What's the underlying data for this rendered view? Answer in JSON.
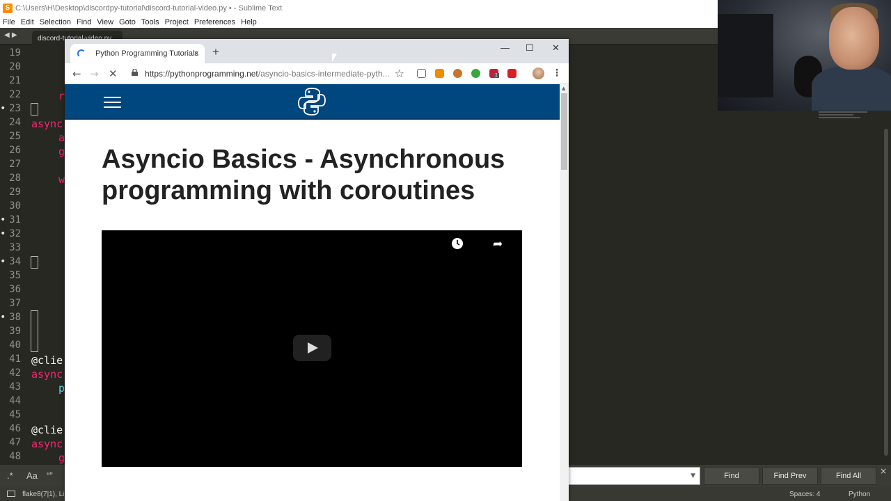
{
  "sublime": {
    "title": "C:\\Users\\H\\Desktop\\discordpy-tutorial\\discord-tutorial-video.py • - Sublime Text",
    "app_icon": "S",
    "menu": [
      "File",
      "Edit",
      "Selection",
      "Find",
      "View",
      "Goto",
      "Tools",
      "Project",
      "Preferences",
      "Help"
    ],
    "tab_label": "discord-tutorial-video.py",
    "line_numbers": [
      "19",
      "20",
      "21",
      "22",
      "23",
      "24",
      "25",
      "26",
      "27",
      "28",
      "29",
      "30",
      "31",
      "32",
      "33",
      "34",
      "35",
      "36",
      "37",
      "38",
      "39",
      "40",
      "41",
      "42",
      "43",
      "44",
      "45",
      "46",
      "47",
      "48"
    ],
    "code_fragments": {
      "l22": "r",
      "l24": "async",
      "l25": "a",
      "l26": "g",
      "l28": "w",
      "l41": "@clie",
      "l42": "async",
      "l43": "p",
      "l46": "@clie",
      "l47": "async",
      "l48": "g"
    },
    "find": {
      "regex": ".*",
      "case": "Aa",
      "word": "“”",
      "find_label": "Find",
      "find_prev_label": "Find Prev",
      "find_all_label": "Find All",
      "close": "×"
    },
    "status": {
      "left": "flake8(7|1), Line",
      "spaces": "Spaces: 4",
      "syntax": "Python"
    }
  },
  "chrome": {
    "tab_title": "Python Programming Tutorials",
    "tab_close": "×",
    "new_tab": "+",
    "minimize": "—",
    "maximize": "☐",
    "close": "✕",
    "url_host": "https://pythonprogramming.net",
    "url_path": "/asyncio-basics-intermediate-pyth...",
    "back": "←",
    "forward": "→",
    "reload": "✕",
    "star": "☆",
    "kebab": "⋮",
    "extension_badge": "1"
  },
  "page": {
    "title": "Asyncio Basics - Asynchronous programming with coroutines"
  },
  "colors": {
    "site_header": "#00467f",
    "editor_bg": "#272822",
    "keyword": "#f92672",
    "function": "#66d9ef"
  }
}
